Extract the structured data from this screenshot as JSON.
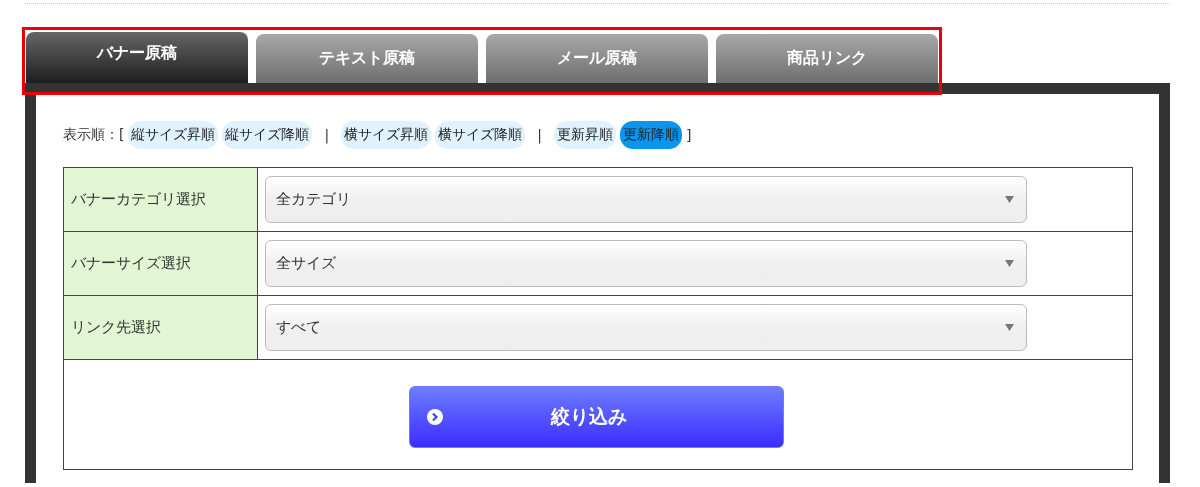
{
  "tabs": [
    {
      "label": "バナー原稿",
      "selected": true
    },
    {
      "label": "テキスト原稿",
      "selected": false
    },
    {
      "label": "メール原稿",
      "selected": false
    },
    {
      "label": "商品リンク",
      "selected": false
    }
  ],
  "sort": {
    "label": "表示順：[",
    "items": [
      {
        "kind": "option",
        "label": "縦サイズ昇順",
        "selected": false
      },
      {
        "kind": "option",
        "label": "縦サイズ降順",
        "selected": false
      },
      {
        "kind": "separator",
        "label": "|"
      },
      {
        "kind": "option",
        "label": "横サイズ昇順",
        "selected": false
      },
      {
        "kind": "option",
        "label": "横サイズ降順",
        "selected": false
      },
      {
        "kind": "separator",
        "label": "|"
      },
      {
        "kind": "option",
        "label": "更新昇順",
        "selected": false
      },
      {
        "kind": "option",
        "label": "更新降順",
        "selected": true
      }
    ],
    "end": "]"
  },
  "filters": [
    {
      "label": "バナーカテゴリ選択",
      "value": "全カテゴリ"
    },
    {
      "label": "バナーサイズ選択",
      "value": "全サイズ"
    },
    {
      "label": "リンク先選択",
      "value": "すべて"
    }
  ],
  "submit": {
    "label": "絞り込み"
  }
}
